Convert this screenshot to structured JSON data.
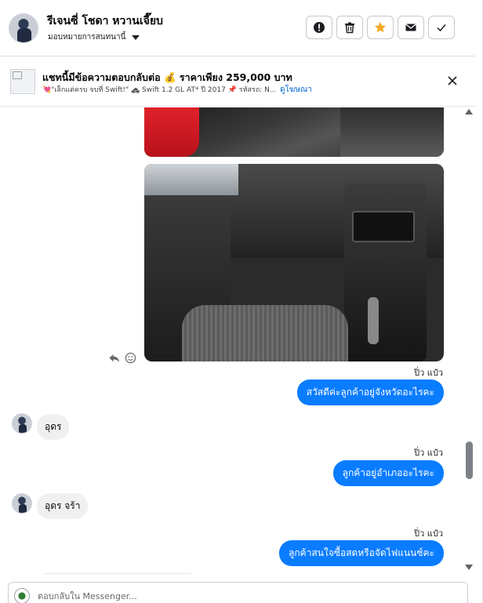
{
  "header": {
    "contact_name": "รีเจนซี่ โชดา หวานเจี๊ยบ",
    "assign_label": "มอบหมายการสนทนานี้",
    "actions": [
      {
        "name": "mark-spam-button",
        "icon": "alert-icon"
      },
      {
        "name": "delete-button",
        "icon": "trash-icon"
      },
      {
        "name": "star-button",
        "icon": "star-icon"
      },
      {
        "name": "mark-unread-button",
        "icon": "mail-icon"
      },
      {
        "name": "mark-done-button",
        "icon": "check-icon"
      }
    ],
    "star_color": "#f5a623"
  },
  "banner": {
    "title": "แชทนี้มีข้อความตอบกลับต่อ 💰 ราคาเพียง 259,000 บาท",
    "subtitle": "💘\"เล็กแต่ครบ จบที่ Swift!\" 🚓 Swift 1.2 GL AT* ปี 2017 📌 รหัสรถ: N...",
    "link": "ดูโฆษณา"
  },
  "messages": [
    {
      "type": "out",
      "sender": "ปิ่ว แป๋ว",
      "text": "สวัสดีค่ะลูกค้าอยู่จังหวัดอะไรคะ"
    },
    {
      "type": "in",
      "text": "อุดร"
    },
    {
      "type": "out",
      "sender": "ปิ่ว แป๋ว",
      "text": "ลูกค้าอยู่อำเภออะไรคะ"
    },
    {
      "type": "in",
      "text": "อุดร  จร้า"
    },
    {
      "type": "out",
      "sender": "ปิ่ว แป๋ว",
      "text": "ลูกค้าสนใจซื้อสดหรือจัดไฟแนนซ์คะ"
    }
  ],
  "composer": {
    "placeholder": "ตอบกลับใน Messenger..."
  },
  "colors": {
    "accent": "#0a7cff",
    "link": "#0064d1"
  }
}
